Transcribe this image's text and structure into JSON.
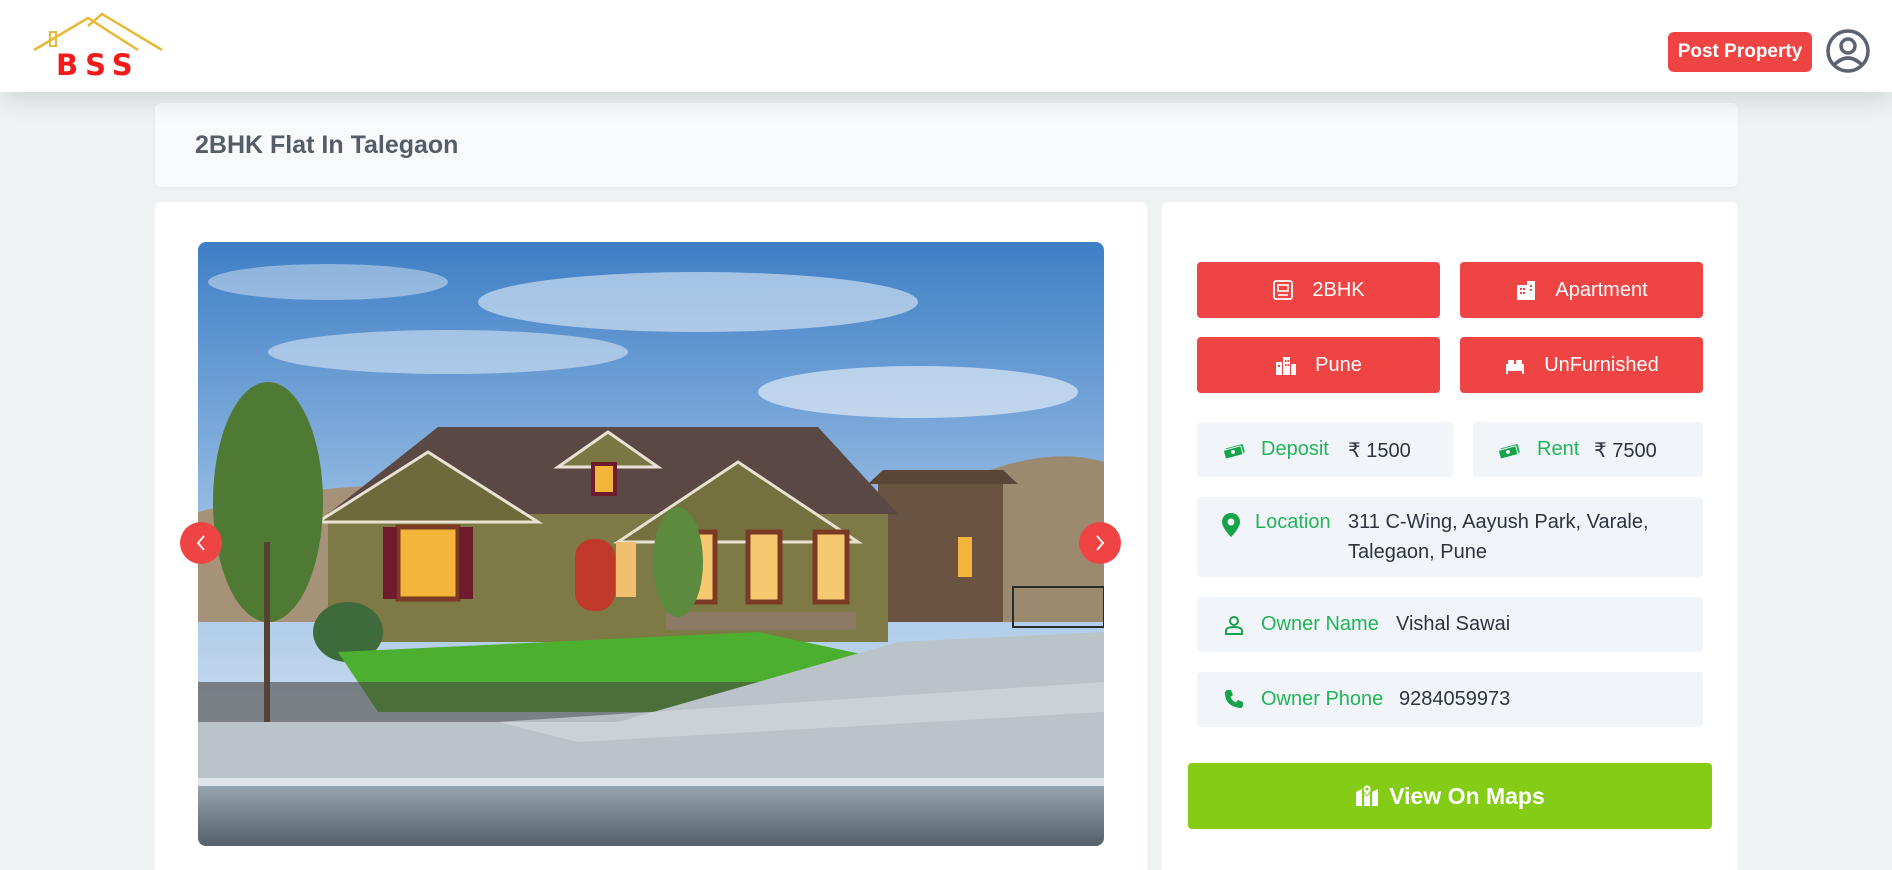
{
  "brand": {
    "logo_text": "BSS",
    "accent": "#ef4444"
  },
  "navbar": {
    "post_property_label": "Post Property",
    "user_icon": "user-circle-icon"
  },
  "listing": {
    "title": "2BHK Flat In Talegaon",
    "carousel": {
      "slide_count": 4,
      "active_slide": 1,
      "prev_icon": "chevron-left-icon",
      "next_icon": "chevron-right-icon"
    },
    "tags": [
      {
        "label": "2BHK",
        "icon": "room-icon"
      },
      {
        "label": "Apartment",
        "icon": "building-icon"
      },
      {
        "label": "Pune",
        "icon": "city-icon"
      },
      {
        "label": "UnFurnished",
        "icon": "bed-icon"
      }
    ],
    "deposit": {
      "label": "Deposit",
      "value": "₹ 1500"
    },
    "rent": {
      "label": "Rent",
      "value": "₹ 7500"
    },
    "location": {
      "label": "Location",
      "value_line1": "311 C-Wing, Aayush Park, Varale,",
      "value_line2": "Talegaon, Pune"
    },
    "owner_name": {
      "label": "Owner Name",
      "value": "Vishal Sawai"
    },
    "owner_phone": {
      "label": "Owner Phone",
      "value": "9284059973"
    },
    "maps_button_label": "View On Maps"
  }
}
